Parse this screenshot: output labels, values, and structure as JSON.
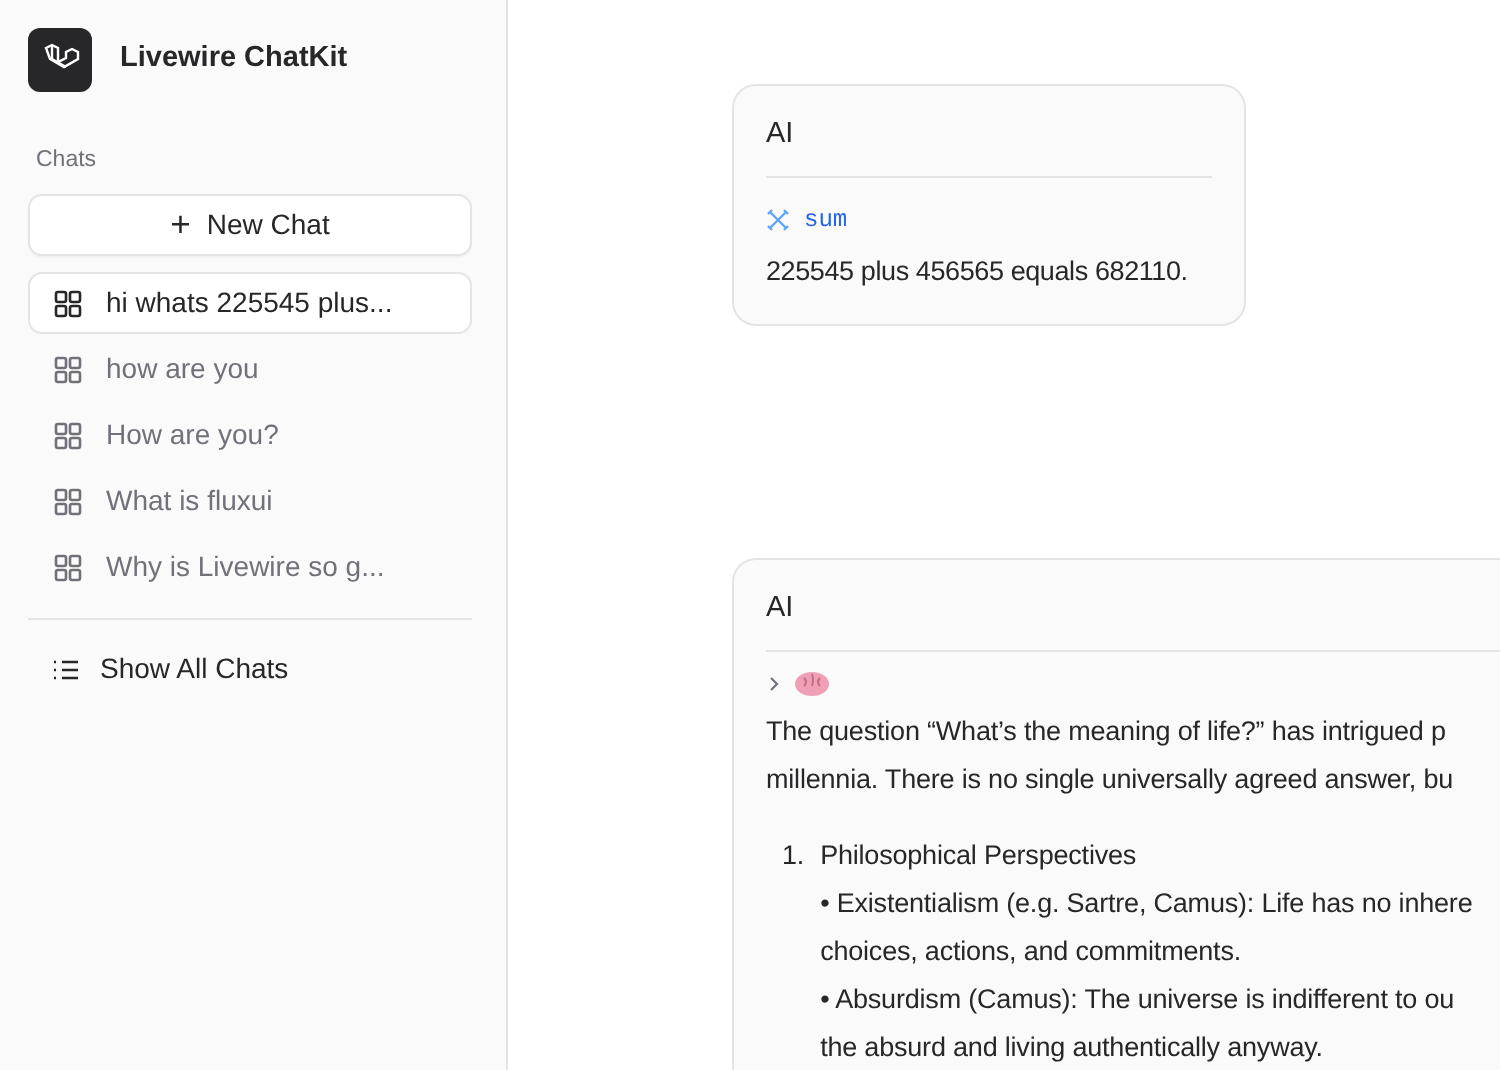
{
  "sidebar": {
    "app_name": "Livewire ChatKit",
    "section_label": "Chats",
    "new_chat": {
      "icon": "+",
      "label": "New Chat"
    },
    "chats": [
      {
        "label": "hi whats 225545 plus...",
        "selected": true
      },
      {
        "label": "how are you",
        "selected": false
      },
      {
        "label": "How are you?",
        "selected": false
      },
      {
        "label": "What is fluxui",
        "selected": false
      },
      {
        "label": "Why is Livewire so g...",
        "selected": false
      }
    ],
    "show_all": "Show All Chats"
  },
  "messages": [
    {
      "kind": "tool",
      "sender": "AI",
      "tool": "sum",
      "text": "225545 plus 456565 equals 682110."
    },
    {
      "kind": "reasoning",
      "sender": "AI",
      "expanded": false,
      "lines": [
        "The question “What’s the meaning of life?” has intrigued p",
        "millennia. There is no single universally agreed answer, bu"
      ],
      "list": [
        {
          "number": "1.",
          "title": "Philosophical Perspectives",
          "lines": [
            "• Existentialism (e.g. Sartre, Camus): Life has no inhere",
            "choices, actions, and commitments.",
            "• Absurdism (Camus): The universe is indifferent to ou",
            "the absurd and living authentically anyway."
          ]
        }
      ]
    }
  ]
}
